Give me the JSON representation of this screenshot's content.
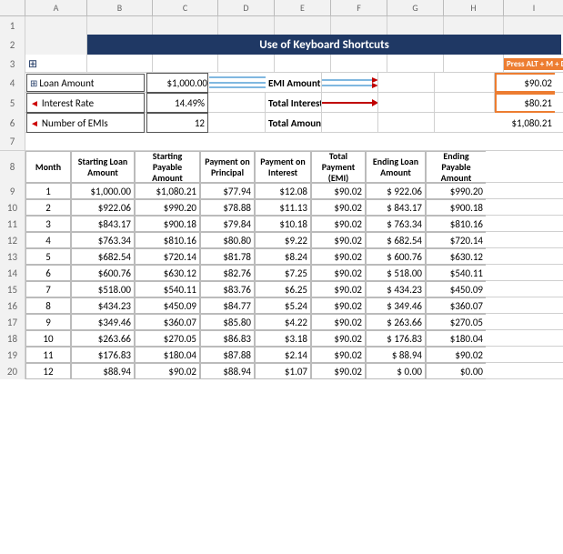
{
  "title": "Use of Keyboard Shortcuts",
  "altBadge": "Press ALT + M + D",
  "colHeaders": [
    "",
    "A",
    "B",
    "C",
    "D",
    "E",
    "F",
    "G",
    "H",
    "I"
  ],
  "rowNumbers": [
    "1",
    "2",
    "3",
    "4",
    "5",
    "6",
    "7",
    "8",
    "9",
    "10",
    "11",
    "12",
    "13",
    "14",
    "15",
    "16",
    "17",
    "18",
    "19",
    "20"
  ],
  "loanInfo": {
    "loanAmountLabel": "Loan Amount",
    "loanAmountValue": "$1,000.00",
    "interestRateLabel": "Interest Rate",
    "interestRateValue": "14.49%",
    "numEMIsLabel": "Number of EMIs",
    "numEMIsValue": "12"
  },
  "emiResults": {
    "emiAmountLabel": "EMI Amount",
    "emiAmountValue": "$90.02",
    "totalInterestLabel": "Total Interest",
    "totalInterestValue": "$80.21",
    "totalAmountLabel": "Total Amount Payable",
    "totalAmountValue": "$1,080.21"
  },
  "tableHeaders": {
    "month": "Month",
    "startingLoanAmount": "Starting Loan Amount",
    "startingPayableAmount": "Starting Payable Amount",
    "paymentOnPrincipal": "Payment on Principal",
    "paymentOnInterest": "Payment on Interest",
    "totalPaymentEMI": "Total Payment (EMI)",
    "endingLoanAmount": "Ending Loan Amount",
    "endingPayableAmount": "Ending Payable Amount"
  },
  "tableData": [
    {
      "month": "1",
      "sla": "$1,000.00",
      "spa": "$1,080.21",
      "pp": "$77.94",
      "pi": "$12.08",
      "temi": "$90.02",
      "ela": "$ 922.06",
      "epa": "$990.20"
    },
    {
      "month": "2",
      "sla": "$922.06",
      "spa": "$990.20",
      "pp": "$78.88",
      "pi": "$11.13",
      "temi": "$90.02",
      "ela": "$ 843.17",
      "epa": "$900.18"
    },
    {
      "month": "3",
      "sla": "$843.17",
      "spa": "$900.18",
      "pp": "$79.84",
      "pi": "$10.18",
      "temi": "$90.02",
      "ela": "$ 763.34",
      "epa": "$810.16"
    },
    {
      "month": "4",
      "sla": "$763.34",
      "spa": "$810.16",
      "pp": "$80.80",
      "pi": "$9.22",
      "temi": "$90.02",
      "ela": "$ 682.54",
      "epa": "$720.14"
    },
    {
      "month": "5",
      "sla": "$682.54",
      "spa": "$720.14",
      "pp": "$81.78",
      "pi": "$8.24",
      "temi": "$90.02",
      "ela": "$ 600.76",
      "epa": "$630.12"
    },
    {
      "month": "6",
      "sla": "$600.76",
      "spa": "$630.12",
      "pp": "$82.76",
      "pi": "$7.25",
      "temi": "$90.02",
      "ela": "$ 518.00",
      "epa": "$540.11"
    },
    {
      "month": "7",
      "sla": "$518.00",
      "spa": "$540.11",
      "pp": "$83.76",
      "pi": "$6.25",
      "temi": "$90.02",
      "ela": "$ 434.23",
      "epa": "$450.09"
    },
    {
      "month": "8",
      "sla": "$434.23",
      "spa": "$450.09",
      "pp": "$84.77",
      "pi": "$5.24",
      "temi": "$90.02",
      "ela": "$ 349.46",
      "epa": "$360.07"
    },
    {
      "month": "9",
      "sla": "$349.46",
      "spa": "$360.07",
      "pp": "$85.80",
      "pi": "$4.22",
      "temi": "$90.02",
      "ela": "$ 263.66",
      "epa": "$270.05"
    },
    {
      "month": "10",
      "sla": "$263.66",
      "spa": "$270.05",
      "pp": "$86.83",
      "pi": "$3.18",
      "temi": "$90.02",
      "ela": "$ 176.83",
      "epa": "$180.04"
    },
    {
      "month": "11",
      "sla": "$176.83",
      "spa": "$180.04",
      "pp": "$87.88",
      "pi": "$2.14",
      "temi": "$90.02",
      "ela": "$  88.94",
      "epa": "$90.02"
    },
    {
      "month": "12",
      "sla": "$88.94",
      "spa": "$90.02",
      "pp": "$88.94",
      "pi": "$1.07",
      "temi": "$90.02",
      "ela": "$    0.00",
      "epa": "$0.00"
    }
  ]
}
